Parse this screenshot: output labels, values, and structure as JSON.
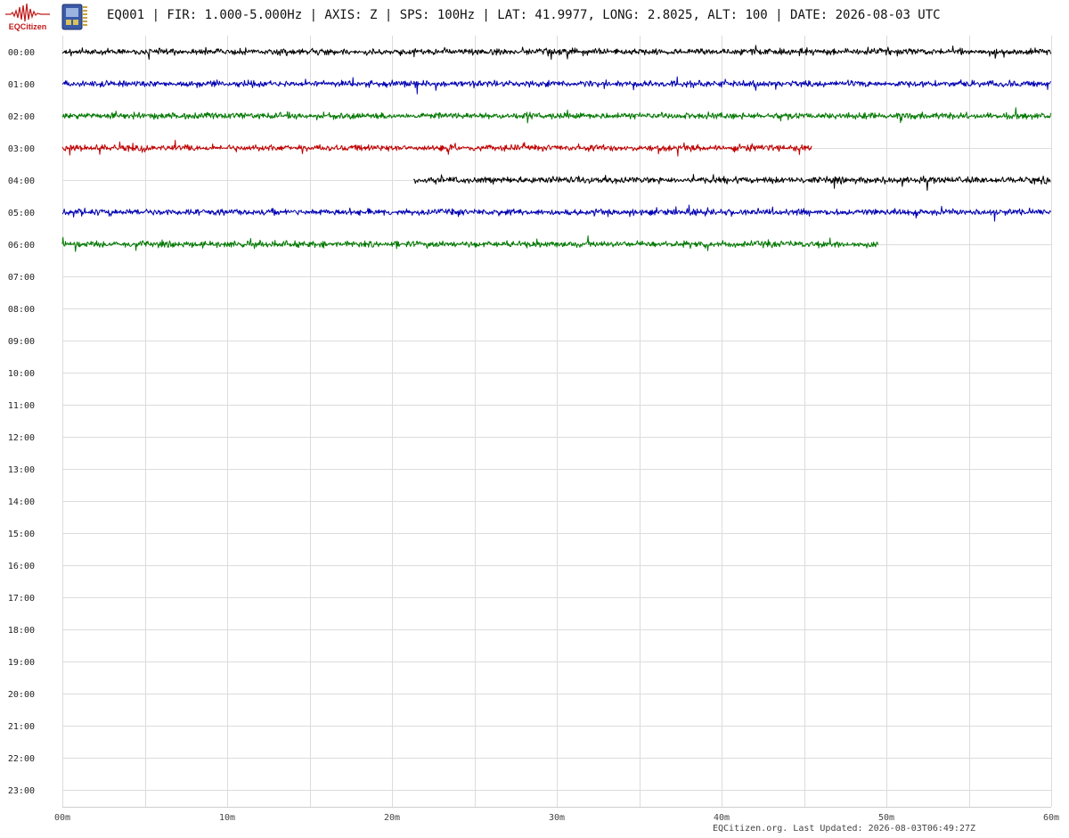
{
  "header": {
    "logo_text": "EQCitizen",
    "logo_icon": "seismogram-logo-icon",
    "device_icon": "sensor-board-icon",
    "title": "EQ001 | FIR: 1.000-5.000Hz | AXIS: Z | SPS: 100Hz | LAT: 41.9977, LONG: 2.8025, ALT: 100 | DATE: 2026-08-03 UTC"
  },
  "footer": {
    "text": "EQCitizen.org. Last Updated: 2026-08-03T06:49:27Z"
  },
  "chart_data": {
    "type": "line",
    "title": "",
    "xlabel": "",
    "ylabel": "",
    "x_ticks": [
      "00m",
      "10m",
      "20m",
      "30m",
      "40m",
      "50m",
      "60m"
    ],
    "xlim": [
      0,
      60
    ],
    "grid": true,
    "row_labels": [
      "00:00",
      "01:00",
      "02:00",
      "03:00",
      "04:00",
      "05:00",
      "06:00",
      "07:00",
      "08:00",
      "09:00",
      "10:00",
      "11:00",
      "12:00",
      "13:00",
      "14:00",
      "15:00",
      "16:00",
      "17:00",
      "18:00",
      "19:00",
      "20:00",
      "21:00",
      "22:00",
      "23:00"
    ],
    "colors": [
      "#000000",
      "#0000b4",
      "#007800",
      "#c00000"
    ],
    "series": [
      {
        "row": "00:00",
        "start_min": 0,
        "end_min": 60,
        "color": "#000000"
      },
      {
        "row": "01:00",
        "start_min": 0,
        "end_min": 60,
        "color": "#0000b4"
      },
      {
        "row": "02:00",
        "start_min": 0,
        "end_min": 60,
        "color": "#007800"
      },
      {
        "row": "03:00",
        "start_min": 0,
        "end_min": 45.5,
        "color": "#c00000"
      },
      {
        "row": "04:00",
        "start_min": 21.3,
        "end_min": 60,
        "color": "#000000"
      },
      {
        "row": "05:00",
        "start_min": 0,
        "end_min": 60,
        "color": "#0000b4"
      },
      {
        "row": "06:00",
        "start_min": 0,
        "end_min": 49.5,
        "color": "#007800"
      }
    ]
  }
}
